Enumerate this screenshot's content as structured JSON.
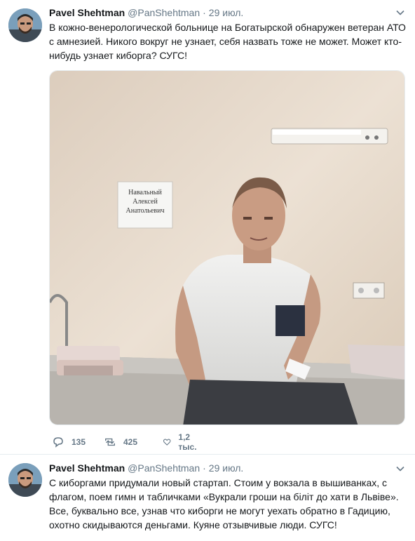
{
  "tweets": [
    {
      "author_name": "Pavel Shehtman",
      "handle": "@PanShehtman",
      "separator": "·",
      "date": "29 июл.",
      "text_lines": [
        "В кожно-венерологической больнице на Богатырской обнаружен ветеран АТО",
        "с амнезией. Никого вокруг не узнает, себя назвать тоже не может. Может кто-",
        "нибудь узнает киборга? СУГС!"
      ],
      "photo": {
        "sign_lines": [
          "Навальный",
          "Алексей",
          "Анатольевич"
        ]
      },
      "actions": {
        "replies": "135",
        "retweets": "425",
        "likes": "1,2 тыс."
      }
    },
    {
      "author_name": "Pavel Shehtman",
      "handle": "@PanShehtman",
      "separator": "·",
      "date": "29 июл.",
      "text_lines": [
        "С киборгами придумали новый стартап. Стоим у вокзала в вышиванках, с",
        "флагом, поем гимн и табличками «Вукрали гроши на біліт до хати в Львіве».",
        "Все, буквально все, узнав что киборги не могут уехать обратно в Гадицию,",
        "охотно скидываются деньгами. Куяне отзывчивые люди. СУГС!"
      ]
    }
  ],
  "colors": {
    "text": "#14171a",
    "secondary": "#657786",
    "border": "#e6ecf0",
    "wall": "#e8dccf"
  },
  "icons": {
    "reply": "reply-icon",
    "retweet": "retweet-icon",
    "like": "heart-icon",
    "menu": "chevron-down-icon"
  }
}
